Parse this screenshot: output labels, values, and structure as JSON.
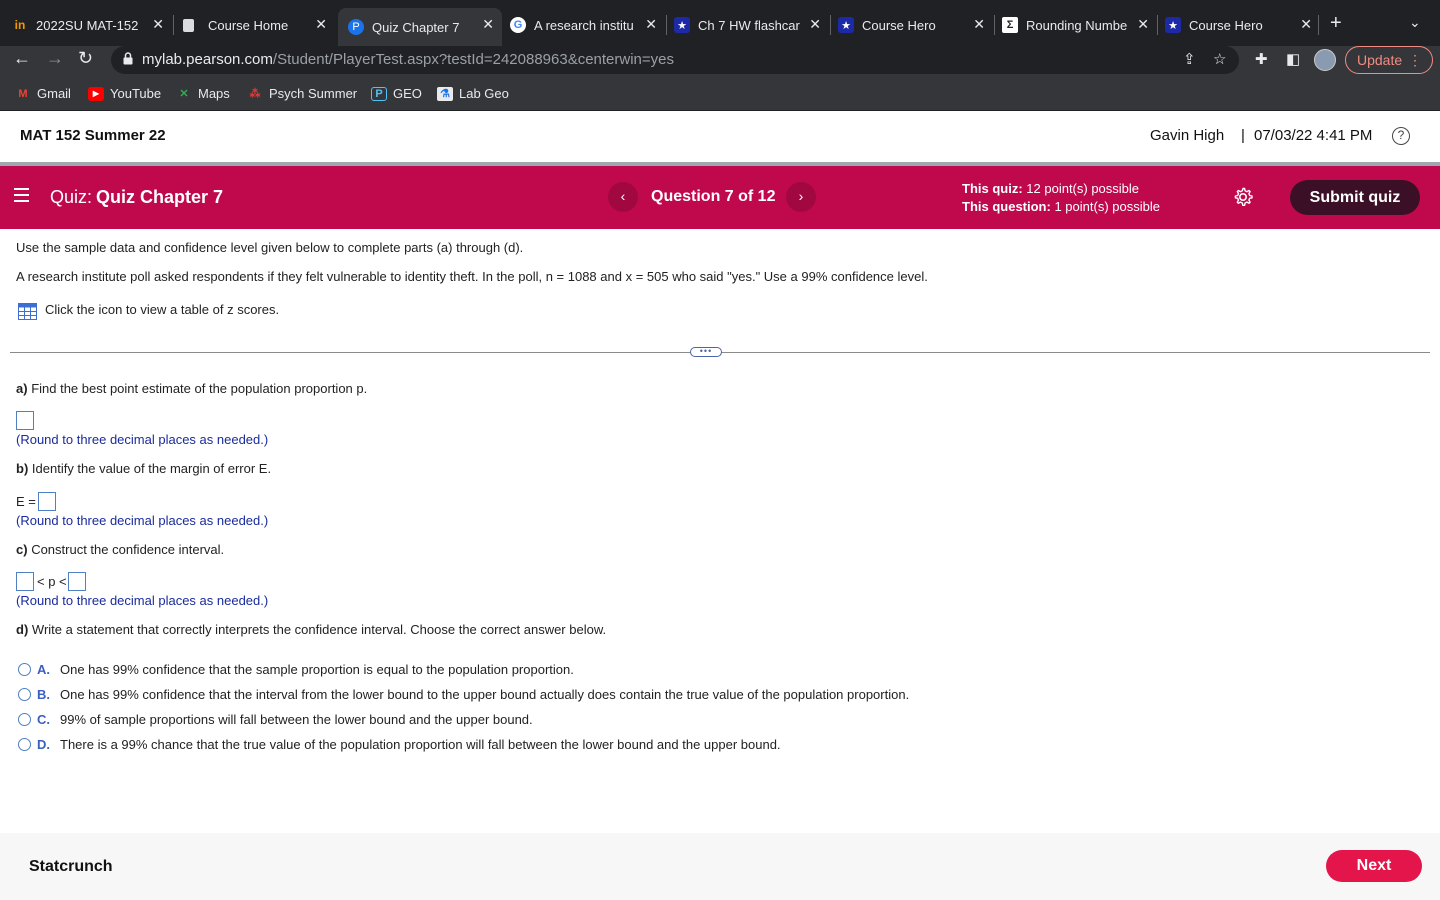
{
  "browser": {
    "tabs": [
      {
        "title": "2022SU MAT-152",
        "icon": "course-icon"
      },
      {
        "title": "Course Home",
        "icon": "page-icon"
      },
      {
        "title": "Quiz Chapter 7",
        "icon": "pearson-icon",
        "active": true
      },
      {
        "title": "A research institu",
        "icon": "google-icon"
      },
      {
        "title": "Ch 7 HW flashcar",
        "icon": "star-icon"
      },
      {
        "title": "Course Hero",
        "icon": "star-icon"
      },
      {
        "title": "Rounding Numbe",
        "icon": "sigma-icon"
      },
      {
        "title": "Course Hero",
        "icon": "star-icon"
      }
    ],
    "url_host": "mylab.pearson.com",
    "url_path": "/Student/PlayerTest.aspx?testId=242088963&centerwin=yes",
    "update_label": "Update",
    "bookmarks": [
      "Gmail",
      "YouTube",
      "Maps",
      "Psych Summer",
      "GEO",
      "Lab Geo"
    ]
  },
  "header": {
    "course": "MAT 152 Summer 22",
    "user": "Gavin High",
    "datetime": "07/03/22 4:41 PM"
  },
  "quiz": {
    "label": "Quiz:",
    "name": "Quiz Chapter 7",
    "question_counter": "Question 7 of 12",
    "quiz_points_label": "This quiz:",
    "quiz_points": "12 point(s) possible",
    "question_points_label": "This question:",
    "question_points": "1 point(s) possible",
    "submit_label": "Submit quiz"
  },
  "question": {
    "intro": "Use the sample data and confidence level given below to complete parts (a) through (d).",
    "problem": "A research institute poll asked respondents if they felt vulnerable to identity theft. In the poll, n = 1088 and x = 505 who said \"yes.\" Use a 99% confidence level.",
    "table_link": "Click the icon to view a table of z scores.",
    "part_a_label": "a)",
    "part_a": "Find the best point estimate of the population proportion p.",
    "round_note": "(Round to three decimal places as needed.)",
    "part_b_label": "b)",
    "part_b": "Identify the value of the margin of error E.",
    "e_label": "E =",
    "part_c_label": "c)",
    "part_c": "Construct the confidence interval.",
    "interval_mid": "< p <",
    "part_d_label": "d)",
    "part_d": "Write a statement that correctly interprets the confidence interval. Choose the correct answer below.",
    "options": [
      {
        "letter": "A.",
        "text": "One has 99% confidence that the sample proportion is equal to the population proportion."
      },
      {
        "letter": "B.",
        "text": "One has 99% confidence that the interval from the lower bound to the upper bound actually does contain the true value of the population proportion."
      },
      {
        "letter": "C.",
        "text": "99% of sample proportions will fall between the lower bound and the upper bound."
      },
      {
        "letter": "D.",
        "text": "There is a 99% chance that the true value of the population proportion will fall between the lower bound and the upper bound."
      }
    ]
  },
  "footer": {
    "statcrunch": "Statcrunch",
    "next_label": "Next"
  },
  "colors": {
    "quiz_bar": "#c0094d",
    "submit": "#3b1027",
    "next": "#e4154b",
    "note": "#1a2b9c"
  }
}
